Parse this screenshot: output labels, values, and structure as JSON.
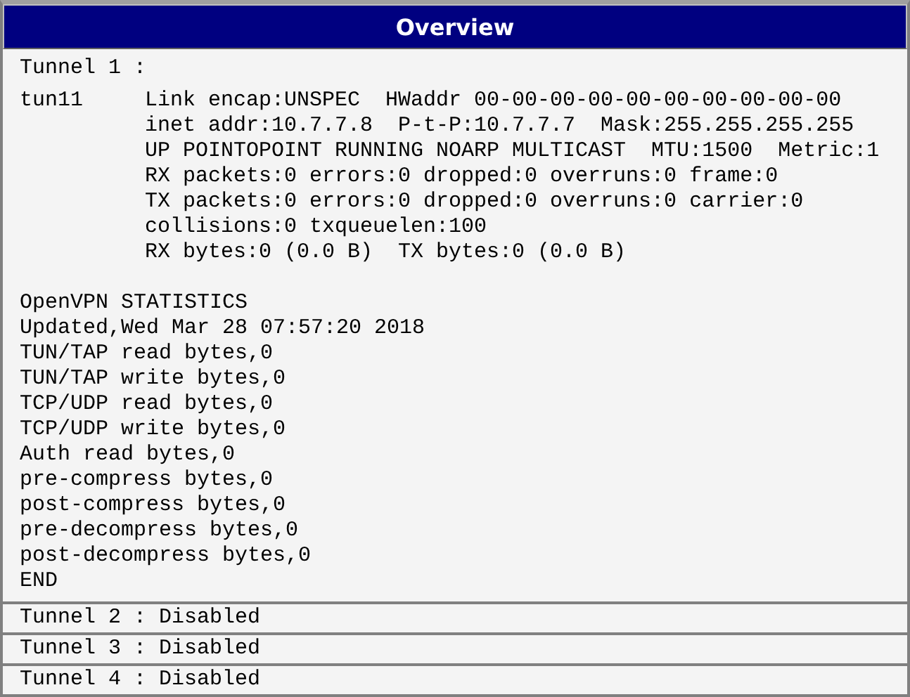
{
  "title": "Overview",
  "tunnels": [
    {
      "header": "Tunnel 1 :",
      "interface": {
        "name": "tun11",
        "lines": [
          "Link encap:UNSPEC  HWaddr 00-00-00-00-00-00-00-00-00-00",
          "inet addr:10.7.7.8  P-t-P:10.7.7.7  Mask:255.255.255.255",
          "UP POINTOPOINT RUNNING NOARP MULTICAST  MTU:1500  Metric:1",
          "RX packets:0 errors:0 dropped:0 overruns:0 frame:0",
          "TX packets:0 errors:0 dropped:0 overruns:0 carrier:0",
          "collisions:0 txqueuelen:100",
          "RX bytes:0 (0.0 B)  TX bytes:0 (0.0 B)"
        ]
      },
      "statistics": [
        "OpenVPN STATISTICS",
        "Updated,Wed Mar 28 07:57:20 2018",
        "TUN/TAP read bytes,0",
        "TUN/TAP write bytes,0",
        "TCP/UDP read bytes,0",
        "TCP/UDP write bytes,0",
        "Auth read bytes,0",
        "pre-compress bytes,0",
        "post-compress bytes,0",
        "pre-decompress bytes,0",
        "post-decompress bytes,0",
        "END"
      ]
    },
    {
      "header": "Tunnel 2 : Disabled"
    },
    {
      "header": "Tunnel 3 : Disabled"
    },
    {
      "header": "Tunnel 4 : Disabled"
    }
  ]
}
